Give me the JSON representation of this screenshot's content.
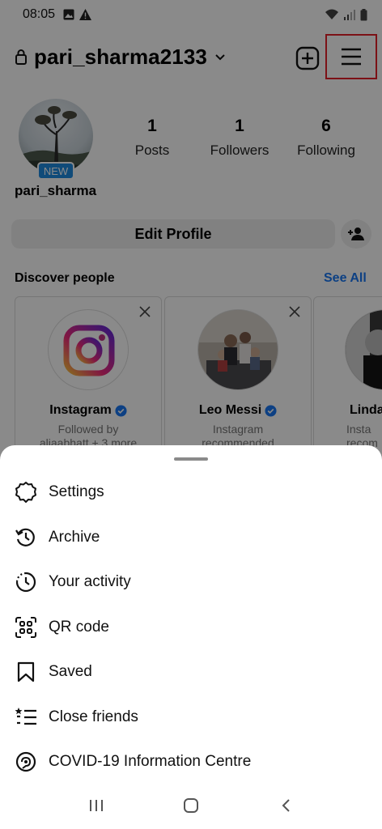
{
  "status_bar": {
    "time": "08:05"
  },
  "header": {
    "username": "pari_sharma2133"
  },
  "profile": {
    "badge": "NEW",
    "display_name": "pari_sharma",
    "stats": [
      {
        "number": "1",
        "label": "Posts"
      },
      {
        "number": "1",
        "label": "Followers"
      },
      {
        "number": "6",
        "label": "Following"
      }
    ],
    "edit_profile_label": "Edit Profile"
  },
  "discover": {
    "title": "Discover people",
    "see_all": "See All",
    "cards": [
      {
        "name": "Instagram",
        "sub1": "Followed by",
        "sub2": "aliaabhatt + 3 more"
      },
      {
        "name": "Leo Messi",
        "sub1": "Instagram",
        "sub2": "recommended"
      },
      {
        "name": "Linda",
        "sub1": "Insta",
        "sub2": "recom"
      }
    ]
  },
  "menu": {
    "items": [
      {
        "label": "Settings",
        "icon": "settings-icon"
      },
      {
        "label": "Archive",
        "icon": "archive-icon"
      },
      {
        "label": "Your activity",
        "icon": "activity-icon"
      },
      {
        "label": "QR code",
        "icon": "qr-code-icon"
      },
      {
        "label": "Saved",
        "icon": "bookmark-icon"
      },
      {
        "label": "Close friends",
        "icon": "close-friends-icon"
      },
      {
        "label": "COVID-19 Information Centre",
        "icon": "covid-info-icon"
      }
    ]
  },
  "colors": {
    "accent": "#1877f2",
    "highlight_border": "#e5202a",
    "badge": "#1f8be0"
  }
}
